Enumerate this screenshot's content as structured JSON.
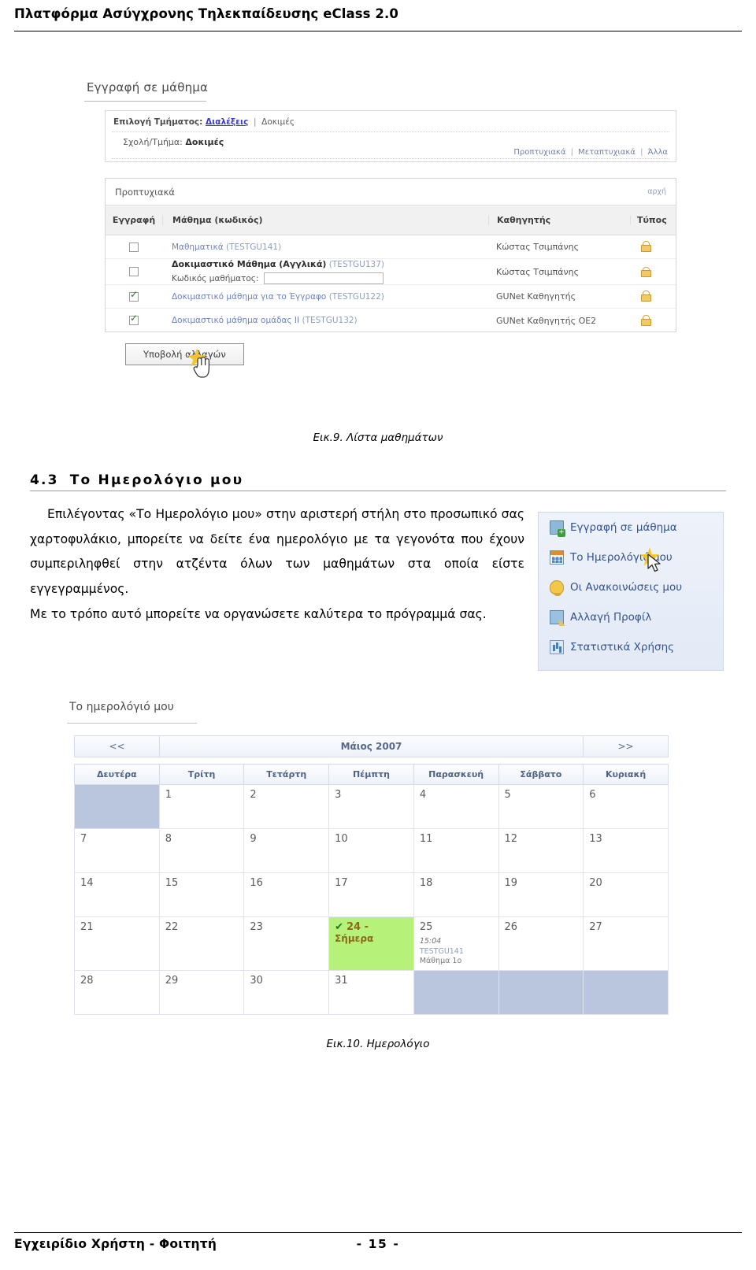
{
  "header": {
    "title": "Πλατφόρμα Ασύγχρονης Τηλεκπαίδευσης eClass 2.0"
  },
  "footer": {
    "left": "Εγχειρίδιο Χρήστη - Φοιτητή",
    "page": "- 15 -"
  },
  "figure9": {
    "caption": "Εικ.9. Λίστα μαθημάτων",
    "screen_title": "Εγγραφή σε μάθημα",
    "dept_label": "Επιλογή Τμήματος:",
    "dept_link": "Διαλέξεις",
    "dept_sep": "|",
    "dept_other": "Δοκιμές",
    "school_label": "Σχολή/Τμήμα:",
    "school_value": "Δοκιμές",
    "levels": [
      "Προπτυχιακά",
      "Μεταπτυχιακά",
      "Άλλα"
    ],
    "category": "Προπτυχιακά",
    "home_link": "αρχή",
    "columns": {
      "reg": "Εγγραφή",
      "course": "Μάθημα (κωδικός)",
      "teacher": "Καθηγητής",
      "type": "Τύπος"
    },
    "rows": [
      {
        "checked": false,
        "name": "Μαθηματικά",
        "code": "(TESTGU141)",
        "teacher": "Κώστας Τσιμπάνης",
        "lock": "lock-open-icon",
        "bold": false,
        "has_code_field": false
      },
      {
        "checked": false,
        "name": "Δοκιμαστικό Μάθημα (Αγγλικά)",
        "code": "(TESTGU137)",
        "teacher": "Κώστας Τσιμπάνης",
        "lock": "lock-closed-icon",
        "bold": true,
        "has_code_field": true,
        "code_field_label": "Κωδικός μαθήματος:",
        "code_field_value": ""
      },
      {
        "checked": true,
        "name": "Δοκιμαστικό μάθημα για το Έγγραφο",
        "code": "(TESTGU122)",
        "teacher": "GUNet Καθηγητής",
        "lock": "lock-open-icon",
        "bold": false,
        "has_code_field": false
      },
      {
        "checked": true,
        "name": "Δοκιμαστικό μάθημα ομάδας ΙΙ",
        "code": "(TESTGU132)",
        "teacher": "GUNet Καθηγητής ΟΕ2",
        "lock": "lock-open-icon",
        "bold": false,
        "has_code_field": false
      }
    ],
    "submit_label": "Υποβολή αλλαγών"
  },
  "section": {
    "number": "4.3",
    "title": "Το Ημερολόγιο μου",
    "paragraph1": "Επιλέγοντας «Το Ημερολόγιο μου» στην αριστερή στήλη στο προσωπικό σας χαρτοφυλάκιο, μπορείτε να δείτε ένα ημερολόγιο με τα γεγονότα που έχουν συμπεριληφθεί στην ατζέντα όλων των μαθημάτων στα οποία είστε εγγεγραμμένος.",
    "paragraph2": "Με το τρόπο αυτό μπορείτε να οργανώσετε καλύτερα το πρόγραμμά σας."
  },
  "tools_panel": {
    "items": [
      {
        "label": "Εγγραφή σε μάθημα",
        "icon": "book-add-icon"
      },
      {
        "label": "Το Ημερολόγιό μου",
        "icon": "calendar-icon"
      },
      {
        "label": "Οι Ανακοινώσεις μου",
        "icon": "bell-icon"
      },
      {
        "label": "Αλλαγή Προφίλ",
        "icon": "profile-edit-icon"
      },
      {
        "label": "Στατιστικά Χρήσης",
        "icon": "statistics-icon"
      }
    ]
  },
  "figure10": {
    "caption": "Εικ.10. Ημερολόγιο",
    "screen_title": "Το ημερολόγιό μου",
    "prev_label": "<<",
    "next_label": ">>",
    "month_label": "Μάιος 2007",
    "day_headers": [
      "Δευτέρα",
      "Τρίτη",
      "Τετάρτη",
      "Πέμπτη",
      "Παρασκευή",
      "Σάββατο",
      "Κυριακή"
    ],
    "weeks": [
      [
        {
          "blank": true
        },
        {
          "day": "1"
        },
        {
          "day": "2"
        },
        {
          "day": "3"
        },
        {
          "day": "4"
        },
        {
          "day": "5"
        },
        {
          "day": "6"
        }
      ],
      [
        {
          "day": "7"
        },
        {
          "day": "8"
        },
        {
          "day": "9"
        },
        {
          "day": "10"
        },
        {
          "day": "11"
        },
        {
          "day": "12"
        },
        {
          "day": "13"
        }
      ],
      [
        {
          "day": "14"
        },
        {
          "day": "15"
        },
        {
          "day": "16"
        },
        {
          "day": "17"
        },
        {
          "day": "18"
        },
        {
          "day": "19"
        },
        {
          "day": "20"
        }
      ],
      [
        {
          "day": "21"
        },
        {
          "day": "22"
        },
        {
          "day": "23"
        },
        {
          "day": "24",
          "today": true,
          "today_label": "Σήμερα",
          "tick": "✔"
        },
        {
          "day": "25",
          "event_time": "15:04",
          "event_code": "TESTGU141",
          "event_name": "Μάθημα 1ο"
        },
        {
          "day": "26"
        },
        {
          "day": "27"
        }
      ],
      [
        {
          "day": "28"
        },
        {
          "day": "29"
        },
        {
          "day": "30"
        },
        {
          "day": "31"
        },
        {
          "blank": true
        },
        {
          "blank": true
        },
        {
          "blank": true
        }
      ]
    ]
  },
  "colors": {
    "today_bg": "#b6f27a",
    "blank_bg": "#b9c6de",
    "link": "#6f83bb",
    "panel_bg": "#eef2fa"
  }
}
